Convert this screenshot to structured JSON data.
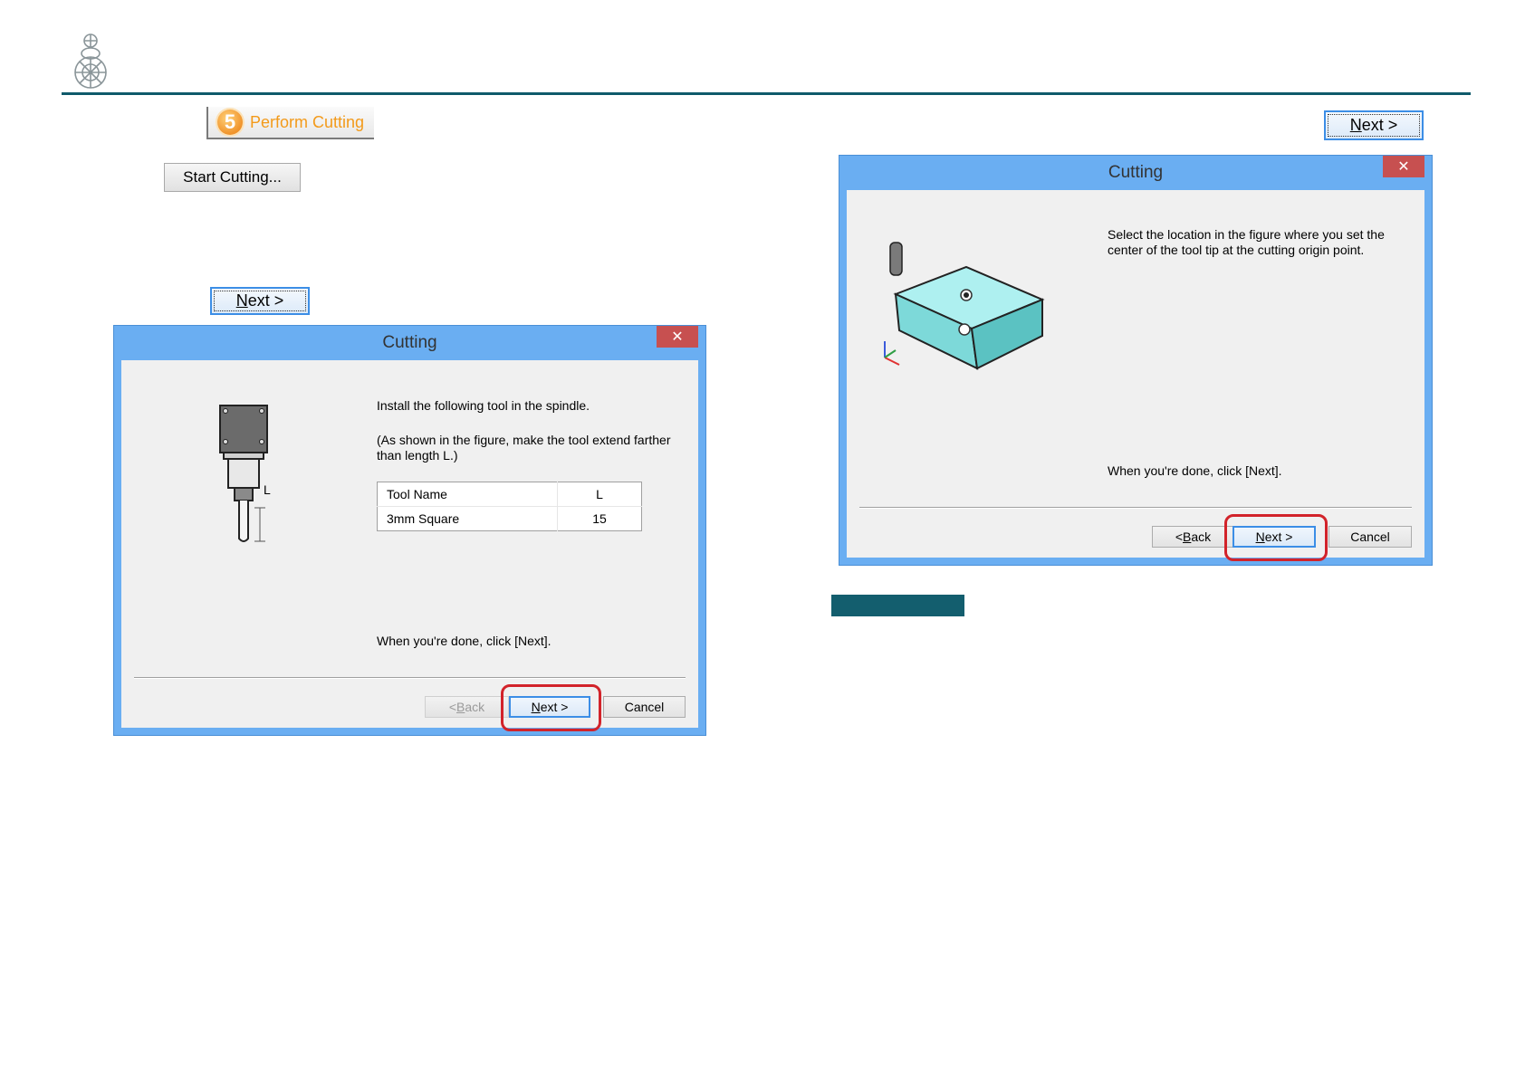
{
  "step_tab": {
    "number": "5",
    "label": "Perform Cutting"
  },
  "start_button": {
    "label": "Start Cutting..."
  },
  "next_button": {
    "prefix": "",
    "mnemonic": "N",
    "rest": "ext >"
  },
  "dialog1": {
    "title": "Cutting",
    "close_glyph": "✕",
    "instruction": "Install the following tool in the spindle.",
    "note_line1": "(As shown in the figure, make the tool extend farther",
    "note_line2": "than length L.)",
    "table": {
      "headers": [
        "Tool Name",
        "L"
      ],
      "rows": [
        [
          "3mm Square",
          "15"
        ]
      ]
    },
    "figure_label": "L",
    "done_text": "When you're done, click [Next].",
    "buttons": {
      "back": {
        "prefix": "< ",
        "mnemonic": "B",
        "rest": "ack"
      },
      "next": {
        "prefix": "",
        "mnemonic": "N",
        "rest": "ext >"
      },
      "cancel": "Cancel"
    }
  },
  "dialog2": {
    "title": "Cutting",
    "close_glyph": "✕",
    "instruction_line1": "Select the location in the figure where you set the",
    "instruction_line2": "center of the tool tip at the cutting origin point.",
    "done_text": "When you're done, click [Next].",
    "buttons": {
      "back": {
        "prefix": "< ",
        "mnemonic": "B",
        "rest": "ack"
      },
      "next": {
        "prefix": "",
        "mnemonic": "N",
        "rest": "ext >"
      },
      "cancel": "Cancel"
    }
  },
  "colors": {
    "header_rule": "#0f5a6b",
    "dialog_frame": "#6aaef2",
    "highlight": "#d2232a",
    "teal_bar": "#135e6e",
    "step_orange": "#f39a1a"
  }
}
